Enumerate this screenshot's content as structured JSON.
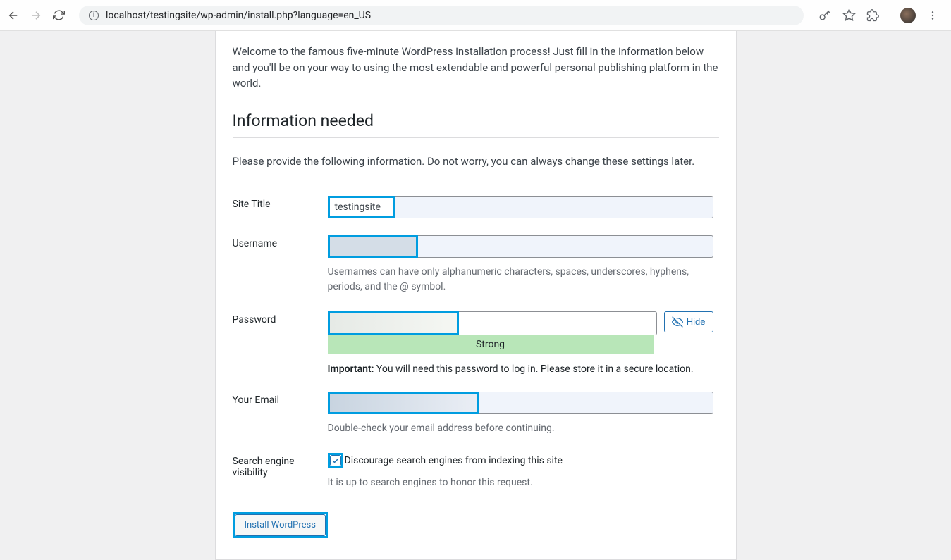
{
  "browser": {
    "url": "localhost/testingsite/wp-admin/install.php?language=en_US"
  },
  "welcome": "Welcome to the famous five-minute WordPress installation process! Just fill in the information below and you'll be on your way to using the most extendable and powerful personal publishing platform in the world.",
  "heading": "Information needed",
  "subnote": "Please provide the following information. Do not worry, you can always change these settings later.",
  "labels": {
    "site_title": "Site Title",
    "username": "Username",
    "password": "Password",
    "your_email": "Your Email",
    "sev": "Search engine visibility"
  },
  "values": {
    "site_title": "testingsite",
    "username": "",
    "password": "",
    "email": "",
    "sev_checked": true
  },
  "hints": {
    "username": "Usernames can have only alphanumeric characters, spaces, underscores, hyphens, periods, and the @ symbol.",
    "password_important_label": "Important:",
    "password_important": " You will need this password to log in. Please store it in a secure location.",
    "email": "Double-check your email address before continuing.",
    "sev_checkbox_label": "Discourage search engines from indexing this site",
    "sev_note": "It is up to search engines to honor this request."
  },
  "password_strength": "Strong",
  "buttons": {
    "hide": "Hide",
    "install": "Install WordPress"
  }
}
